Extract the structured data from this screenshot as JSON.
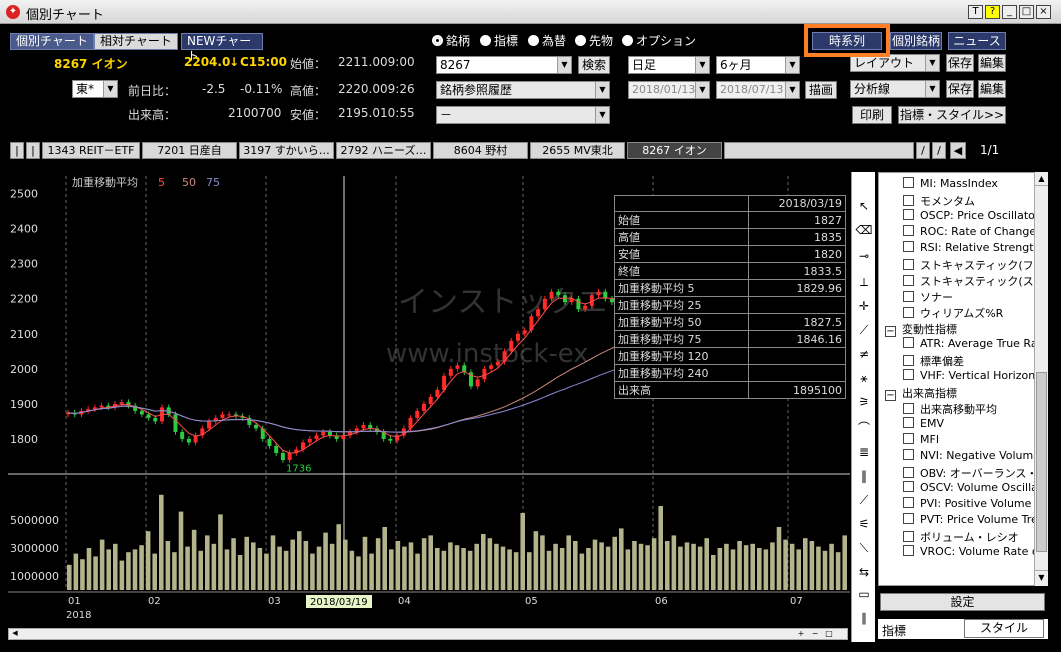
{
  "window": {
    "title": "個別チャート",
    "buttons": [
      "T",
      "?",
      "_",
      "□",
      "×"
    ]
  },
  "top_tabs": [
    "個別チャート",
    "相対チャート",
    "NEWチャート"
  ],
  "radio_options": [
    {
      "label": "銘柄",
      "selected": true
    },
    {
      "label": "指標",
      "selected": false
    },
    {
      "label": "為替",
      "selected": false
    },
    {
      "label": "先物",
      "selected": false
    },
    {
      "label": "オプション",
      "selected": false
    }
  ],
  "right_buttons": {
    "timeseries": "時系列",
    "stock": "個別銘柄",
    "news": "ニュース"
  },
  "stock_info": {
    "code_name": "8267 イオン",
    "price": "2204.0",
    "arrow": "↓",
    "time": "C15:00",
    "exchange": "東*",
    "change_label": "前日比：",
    "change": "-2.5",
    "change_pct": "-0.11%",
    "volume_label": "出来高：",
    "volume": "2100700",
    "open_label": "始値：",
    "open": "2211.0",
    "open_time": "09:00",
    "high_label": "高値：",
    "high": "2220.0",
    "high_time": "09:26",
    "low_label": "安値：",
    "low": "2195.0",
    "low_time": "10:55"
  },
  "controls": {
    "code_input": "8267",
    "search_btn": "検索",
    "history": "銘柄参照履歴",
    "blank_select": "－",
    "period": "日足",
    "range": "6ヶ月",
    "date_from": "2018/01/13",
    "date_to": "2018/07/13",
    "draw_btn": "描画",
    "layout": "レイアウト",
    "save1": "保存",
    "edit1": "編集",
    "analysis": "分析線",
    "save2": "保存",
    "edit2": "編集",
    "print": "印刷",
    "indicator_style": "指標・スタイル>>"
  },
  "stock_tabs": [
    "1343 REIT－ETF",
    "7201 日産自",
    "3197 すかいら…",
    "2792 ハニーズ…",
    "8604 野村",
    "2655 MV東北",
    "8267 イオン"
  ],
  "page_indicator": "1/1",
  "chart": {
    "ma_label": "加重移動平均",
    "ma_periods": [
      "5",
      "50",
      "75"
    ],
    "ma_colors": [
      "#ff4d4d",
      "#c98a7a",
      "#8a8ad6"
    ],
    "watermark1": "インストックエクス",
    "watermark2": "www.instock-ex",
    "low_label": "1736",
    "cursor_date": "2018/03/19",
    "year_label": "2018",
    "month_ticks": [
      "01",
      "02",
      "03",
      "04",
      "05",
      "06",
      "07"
    ],
    "price_ticks": [
      "2500",
      "2400",
      "2300",
      "2200",
      "2100",
      "2000",
      "1900",
      "1800"
    ],
    "volume_ticks": [
      "5000000",
      "3000000",
      "1000000"
    ]
  },
  "chart_data": {
    "type": "candlestick",
    "title": "",
    "ylim": [
      1700,
      2550
    ],
    "close": [
      1875,
      1870,
      1880,
      1885,
      1890,
      1895,
      1890,
      1900,
      1905,
      1895,
      1880,
      1870,
      1860,
      1850,
      1890,
      1870,
      1820,
      1800,
      1790,
      1810,
      1830,
      1850,
      1860,
      1870,
      1870,
      1865,
      1860,
      1840,
      1830,
      1800,
      1780,
      1760,
      1740,
      1760,
      1770,
      1790,
      1800,
      1810,
      1820,
      1810,
      1800,
      1810,
      1820,
      1830,
      1840,
      1830,
      1820,
      1800,
      1795,
      1810,
      1830,
      1860,
      1880,
      1900,
      1920,
      1940,
      1980,
      2000,
      2010,
      1990,
      1950,
      1970,
      2000,
      2010,
      2020,
      2050,
      2080,
      2100,
      2110,
      2150,
      2170,
      2200,
      2220,
      2210,
      2190,
      2200,
      2170,
      2180,
      2210,
      2220,
      2200,
      2190,
      2200,
      2180,
      2190
    ],
    "volume_ylim": [
      0,
      8000000
    ],
    "volume": [
      1800000,
      2600000,
      2200000,
      3000000,
      2400000,
      3600000,
      2900000,
      3300000,
      2100000,
      2700000,
      2900000,
      3200000,
      4200000,
      2600000,
      6800000,
      3500000,
      2700000,
      5600000,
      3100000,
      4300000,
      2800000,
      3900000,
      3300000,
      5400000,
      2900000,
      3700000,
      2500000,
      3800000,
      3400000,
      3000000,
      2600000,
      3900000,
      3100000,
      2800000,
      3600000,
      4200000,
      3500000,
      2600000,
      3100000,
      4100000,
      3300000,
      4700000,
      3600000,
      2800000,
      2400000,
      3800000,
      2600000,
      3700000,
      4500000,
      2900000,
      3500000,
      3100000,
      3400000,
      2600000,
      3700000,
      3900000,
      3000000,
      2800000,
      3400000,
      3200000,
      3000000,
      2800000,
      3300000,
      4000000,
      3700000,
      3300000,
      3100000,
      2900000,
      2700000,
      5500000,
      2700000,
      4200000,
      3900000,
      2800000,
      3300000,
      3000000,
      3900000,
      3500000,
      2600000,
      3000000,
      3600000,
      3400000,
      3100000,
      3800000,
      4400000,
      2900000,
      3500000,
      3300000,
      3200000,
      3700000,
      6000000,
      3500000,
      3900000,
      3100000,
      3400000,
      3300000,
      3100000,
      3700000,
      2500000,
      3000000,
      3300000,
      2900000,
      3500000,
      3200000,
      3300000,
      3000000,
      2900000,
      3400000,
      4500000,
      3600000,
      3300000,
      2900000,
      3700000,
      3500000,
      3100000,
      2800000,
      3300000,
      2700000,
      3900000
    ]
  },
  "info_table": {
    "date": "2018/03/19",
    "rows": [
      {
        "label": "始値",
        "value": "1827"
      },
      {
        "label": "高値",
        "value": "1835"
      },
      {
        "label": "安値",
        "value": "1820"
      },
      {
        "label": "終値",
        "value": "1833.5"
      },
      {
        "label": "加重移動平均 5",
        "value": "1829.96"
      },
      {
        "label": "加重移動平均 25",
        "value": ""
      },
      {
        "label": "加重移動平均 50",
        "value": "1827.5"
      },
      {
        "label": "加重移動平均 75",
        "value": "1846.16"
      },
      {
        "label": "加重移動平均 120",
        "value": ""
      },
      {
        "label": "加重移動平均 240",
        "value": ""
      },
      {
        "label": "出来高",
        "value": "1895100"
      }
    ]
  },
  "indicators": [
    {
      "label": "MI: MassIndex",
      "group": false
    },
    {
      "label": "モメンタム",
      "group": false
    },
    {
      "label": "OSCP: Price Oscillator",
      "group": false
    },
    {
      "label": "ROC: Rate of Change",
      "group": false
    },
    {
      "label": "RSI: Relative Strength",
      "group": false
    },
    {
      "label": "ストキャスティック(ファスト)",
      "group": false
    },
    {
      "label": "ストキャスティック(スロー)",
      "group": false
    },
    {
      "label": "ソナー",
      "group": false
    },
    {
      "label": "ウィリアムズ%R",
      "group": false
    },
    {
      "label": "変動性指標",
      "group": true
    },
    {
      "label": "ATR: Average True Range",
      "group": false
    },
    {
      "label": "標準偏差",
      "group": false
    },
    {
      "label": "VHF: Vertical Horizontal",
      "group": false
    },
    {
      "label": "出来高指標",
      "group": true
    },
    {
      "label": "出来高移動平均",
      "group": false
    },
    {
      "label": "EMV",
      "group": false
    },
    {
      "label": "MFI",
      "group": false
    },
    {
      "label": "NVI: Negative Volume",
      "group": false
    },
    {
      "label": "OBV: オーバーランス・ボリューム",
      "group": false
    },
    {
      "label": "OSCV: Volume Oscillator",
      "group": false
    },
    {
      "label": "PVI: Positive Volume",
      "group": false
    },
    {
      "label": "PVT: Price Volume Trend",
      "group": false
    },
    {
      "label": "ボリューム・レシオ",
      "group": false
    },
    {
      "label": "VROC: Volume Rate of Change",
      "group": false
    }
  ],
  "setting_btn": "設定",
  "bottom_tabs": [
    "指標",
    "スタイル"
  ]
}
